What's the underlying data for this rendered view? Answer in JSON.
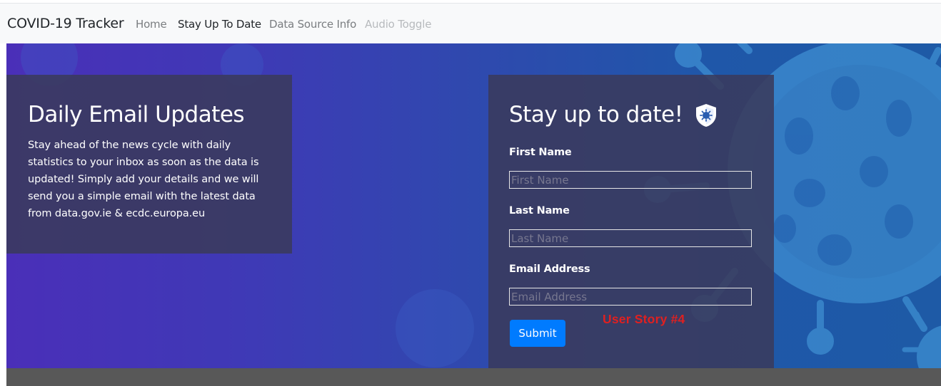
{
  "navbar": {
    "brand": "COVID-19 Tracker",
    "links": [
      {
        "label": "Home",
        "state": "normal"
      },
      {
        "label": "Stay Up To Date",
        "state": "active"
      },
      {
        "label": "Data Source Info",
        "state": "normal"
      },
      {
        "label": "Audio Toggle",
        "state": "disabled"
      }
    ]
  },
  "hero": {
    "info_panel": {
      "title": "Daily Email Updates",
      "text": "Stay ahead of the news cycle with daily statistics to your inbox as soon as the data is updated! Simply add your details and we will send you a simple email with the latest data from data.gov.ie & ecdc.europa.eu"
    },
    "form_panel": {
      "title": "Stay up to date!",
      "title_icon": "virus-shield-icon",
      "fields": [
        {
          "label": "First Name",
          "placeholder": "First Name",
          "value": ""
        },
        {
          "label": "Last Name",
          "placeholder": "Last Name",
          "value": ""
        },
        {
          "label": "Email Address",
          "placeholder": "Email Address",
          "value": ""
        }
      ],
      "submit_label": "Submit",
      "annotation": "User Story #4"
    }
  },
  "colors": {
    "navbar_bg": "#f8f9fa",
    "hero_gradient_left": "#4a2fb8",
    "hero_gradient_right": "#1e5aa6",
    "panel_bg": "#3a3a5c",
    "submit_button": "#007bff",
    "annotation": "#e02020",
    "footer_bar": "#585858"
  }
}
